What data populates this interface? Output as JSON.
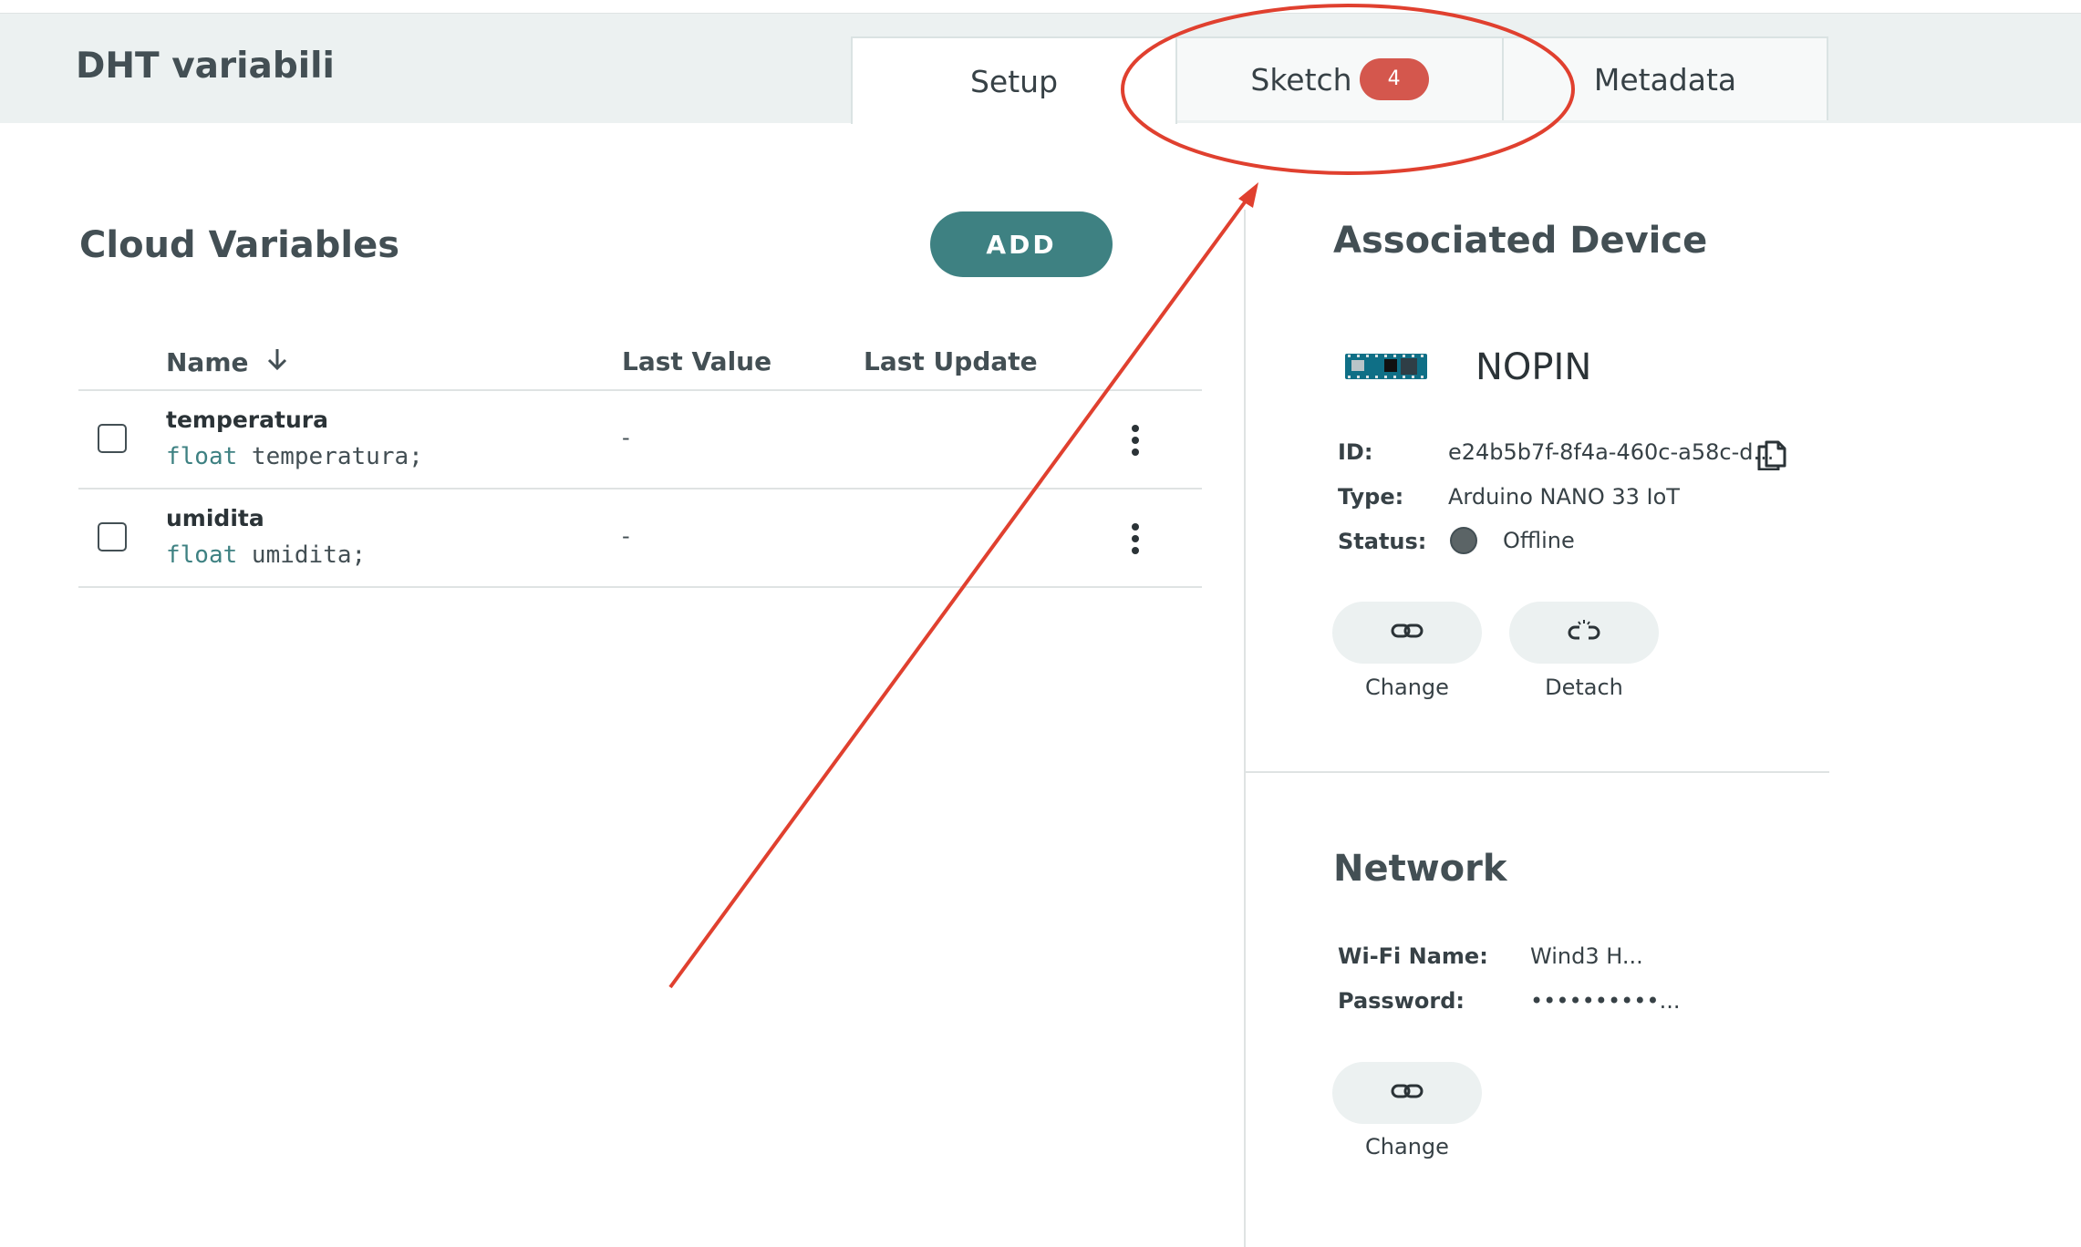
{
  "thing": {
    "title": "DHT variabili"
  },
  "tabs": [
    {
      "label": "Setup"
    },
    {
      "label": "Sketch",
      "badge": "4"
    },
    {
      "label": "Metadata"
    }
  ],
  "cloud_variables": {
    "title": "Cloud Variables",
    "add_label": "ADD",
    "columns": {
      "name": "Name",
      "last_value": "Last Value",
      "last_update": "Last Update"
    },
    "rows": [
      {
        "name": "temperatura",
        "type": "float",
        "decl_rest": " temperatura;",
        "last_value": "-",
        "last_update": ""
      },
      {
        "name": "umidita",
        "type": "float",
        "decl_rest": " umidita;",
        "last_value": "-",
        "last_update": ""
      }
    ]
  },
  "device": {
    "title": "Associated Device",
    "name": "NOPIN",
    "id_label": "ID:",
    "id_value": "e24b5b7f-8f4a-460c-a58c-d...",
    "type_label": "Type:",
    "type_value": "Arduino NANO 33 IoT",
    "status_label": "Status:",
    "status_value": "Offline",
    "change_label": "Change",
    "detach_label": "Detach"
  },
  "network": {
    "title": "Network",
    "wifi_label": "Wi-Fi Name:",
    "wifi_value": "Wind3 H...",
    "password_label": "Password:",
    "password_value": "••••••••••...",
    "change_label": "Change"
  },
  "colors": {
    "accent": "#3e8182",
    "badge": "#d4574d",
    "annotation": "#e0402f"
  }
}
